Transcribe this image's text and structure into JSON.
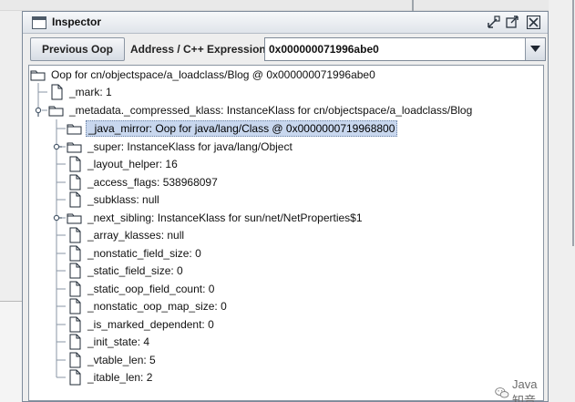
{
  "window": {
    "title": "Inspector"
  },
  "toolbar": {
    "previous_label": "Previous Oop",
    "address_label": "Address / C++ Expression:",
    "address_value": "0x000000071996abe0"
  },
  "tree": {
    "root": "Oop for cn/objectspace/a_loadclass/Blog @ 0x000000071996abe0",
    "mark": "_mark: 1",
    "metadata": "_metadata._compressed_klass: InstanceKlass for cn/objectspace/a_loadclass/Blog",
    "children": [
      {
        "label": "_java_mirror: Oop for java/lang/Class @ 0x0000000719968800",
        "kind": "folder",
        "selected": true
      },
      {
        "label": "_super: InstanceKlass for java/lang/Object",
        "kind": "folder"
      },
      {
        "label": "_layout_helper: 16",
        "kind": "file"
      },
      {
        "label": "_access_flags: 538968097",
        "kind": "file"
      },
      {
        "label": "_subklass: null",
        "kind": "file"
      },
      {
        "label": "_next_sibling: InstanceKlass for sun/net/NetProperties$1",
        "kind": "folder"
      },
      {
        "label": "_array_klasses: null",
        "kind": "file"
      },
      {
        "label": "_nonstatic_field_size: 0",
        "kind": "file"
      },
      {
        "label": "_static_field_size: 0",
        "kind": "file"
      },
      {
        "label": "_static_oop_field_count: 0",
        "kind": "file"
      },
      {
        "label": "_nonstatic_oop_map_size: 0",
        "kind": "file"
      },
      {
        "label": "_is_marked_dependent: 0",
        "kind": "file"
      },
      {
        "label": "_init_state: 4",
        "kind": "file"
      },
      {
        "label": "_vtable_len: 5",
        "kind": "file"
      },
      {
        "label": "_itable_len: 2",
        "kind": "file"
      }
    ]
  },
  "watermark": {
    "text": "Java知音"
  },
  "colors": {
    "selection": "#c8d7ee",
    "tree_line": "#8a96a4",
    "border": "#7d8a9a"
  },
  "icons": {
    "title": "window-icon",
    "folder": "folder-icon",
    "file": "file-icon",
    "collapse": "tree-collapse-handle",
    "expand": "tree-expand-handle"
  }
}
